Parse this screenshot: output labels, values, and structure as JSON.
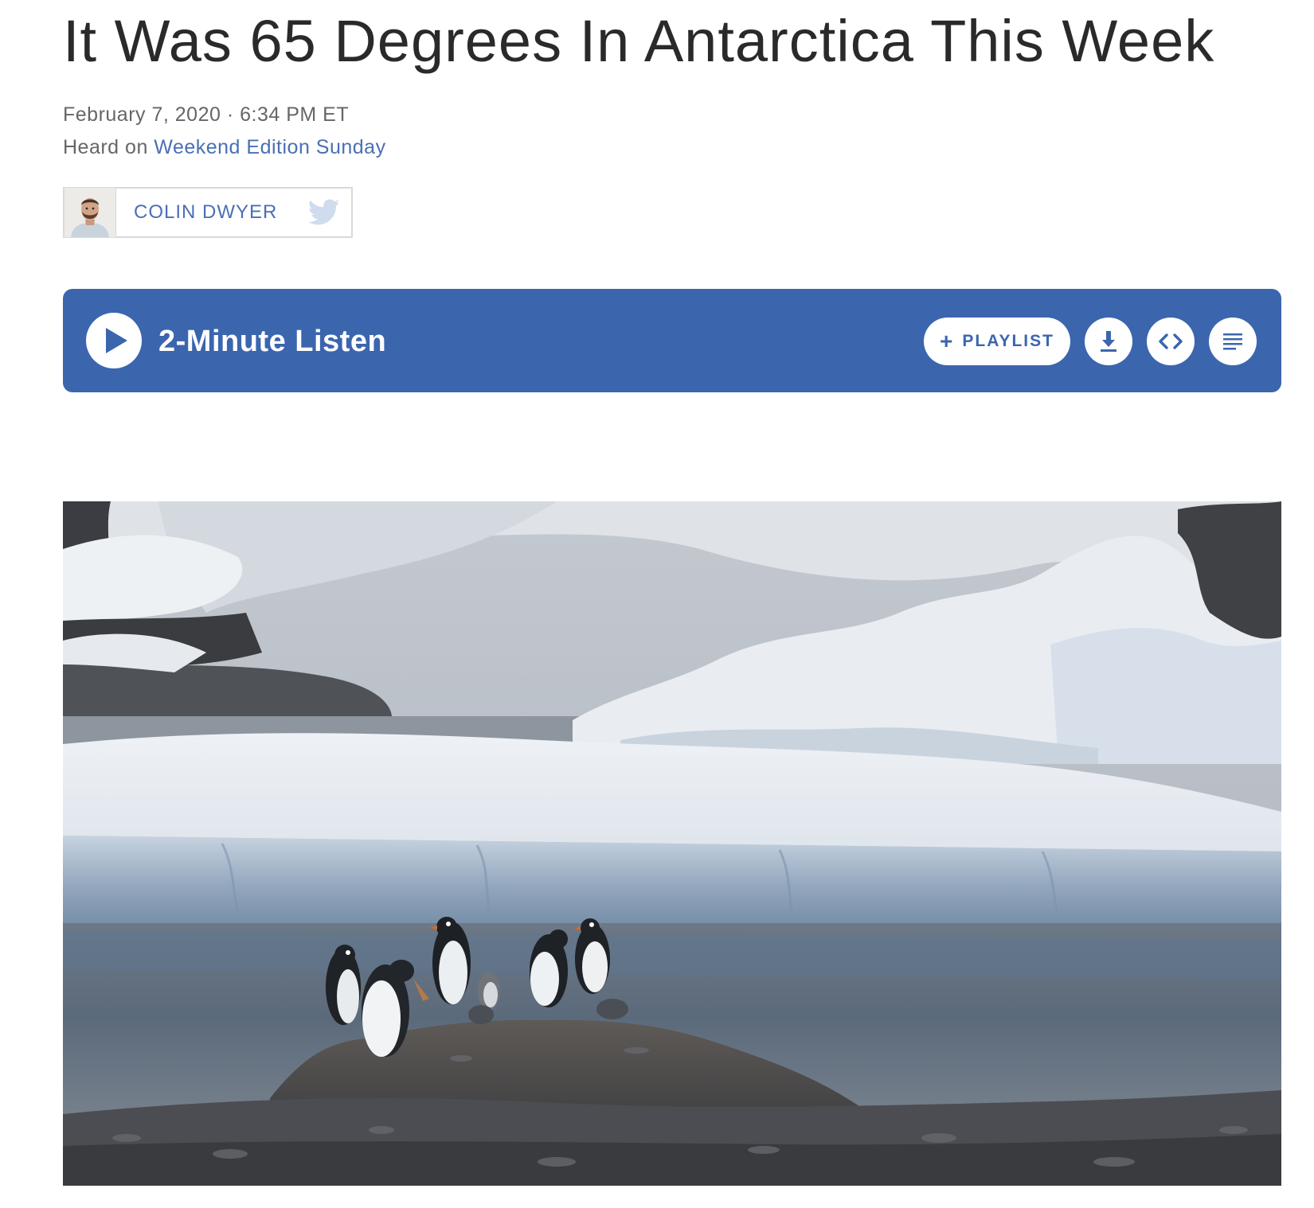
{
  "article": {
    "headline": "It Was 65 Degrees In Antarctica This Week",
    "date": "February 7, 2020",
    "separator": " · ",
    "time": "6:34 PM ET",
    "heard_on_prefix": "Heard on ",
    "program": "Weekend Edition Sunday",
    "author": "COLIN DWYER"
  },
  "player": {
    "listen_label": "2-Minute Listen",
    "playlist_plus": "+",
    "playlist_label": "PLAYLIST"
  },
  "icons": {
    "author_social": "twitter-icon",
    "play": "play-icon",
    "download": "download-icon",
    "embed": "embed-icon",
    "transcript": "transcript-icon"
  },
  "colors": {
    "accent": "#3b66ae",
    "link": "#4a6fb5",
    "headline": "#2a2a2a",
    "meta": "#666666"
  }
}
